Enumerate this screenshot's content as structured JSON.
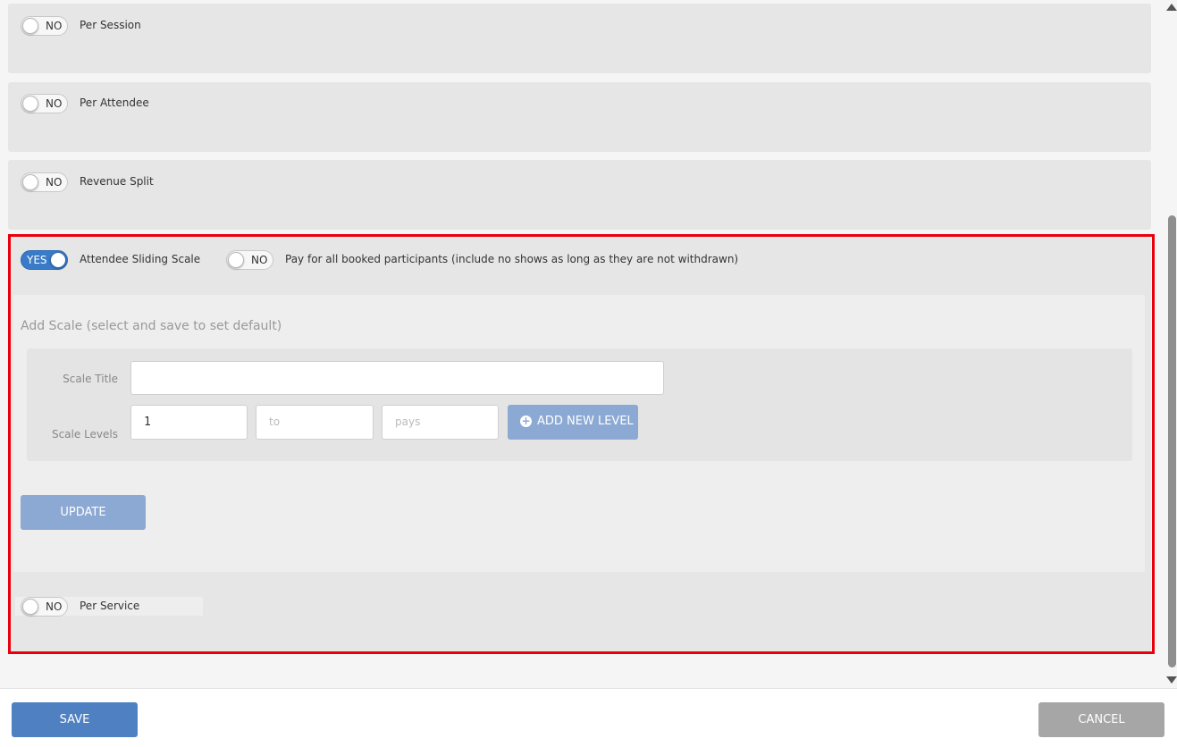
{
  "rows": {
    "per_session": {
      "toggle": "NO",
      "label": "Per Session"
    },
    "per_attendee": {
      "toggle": "NO",
      "label": "Per Attendee"
    },
    "revenue_split": {
      "toggle": "NO",
      "label": "Revenue Split"
    },
    "sliding_scale": {
      "toggle": "YES",
      "label": "Attendee Sliding Scale"
    },
    "pay_all": {
      "toggle": "NO",
      "label": "Pay for all booked participants (include no shows as long as they are not withdrawn)"
    },
    "per_service": {
      "toggle": "NO",
      "label": "Per Service"
    }
  },
  "scale_form": {
    "title": "Add Scale (select and save to set default)",
    "scale_title_label": "Scale Title",
    "scale_title_value": "",
    "scale_levels_label": "Scale Levels",
    "level_from_value": "1",
    "level_to_placeholder": "to",
    "level_pays_placeholder": "pays",
    "add_level_label": "ADD NEW LEVEL",
    "update_label": "UPDATE"
  },
  "footer": {
    "save_label": "SAVE",
    "cancel_label": "CANCEL"
  },
  "colors": {
    "highlight": "#e8000d",
    "primary": "#4f80c1",
    "primary_disabled": "#8ca9d3",
    "toggle_on": "#3a7bc8"
  }
}
